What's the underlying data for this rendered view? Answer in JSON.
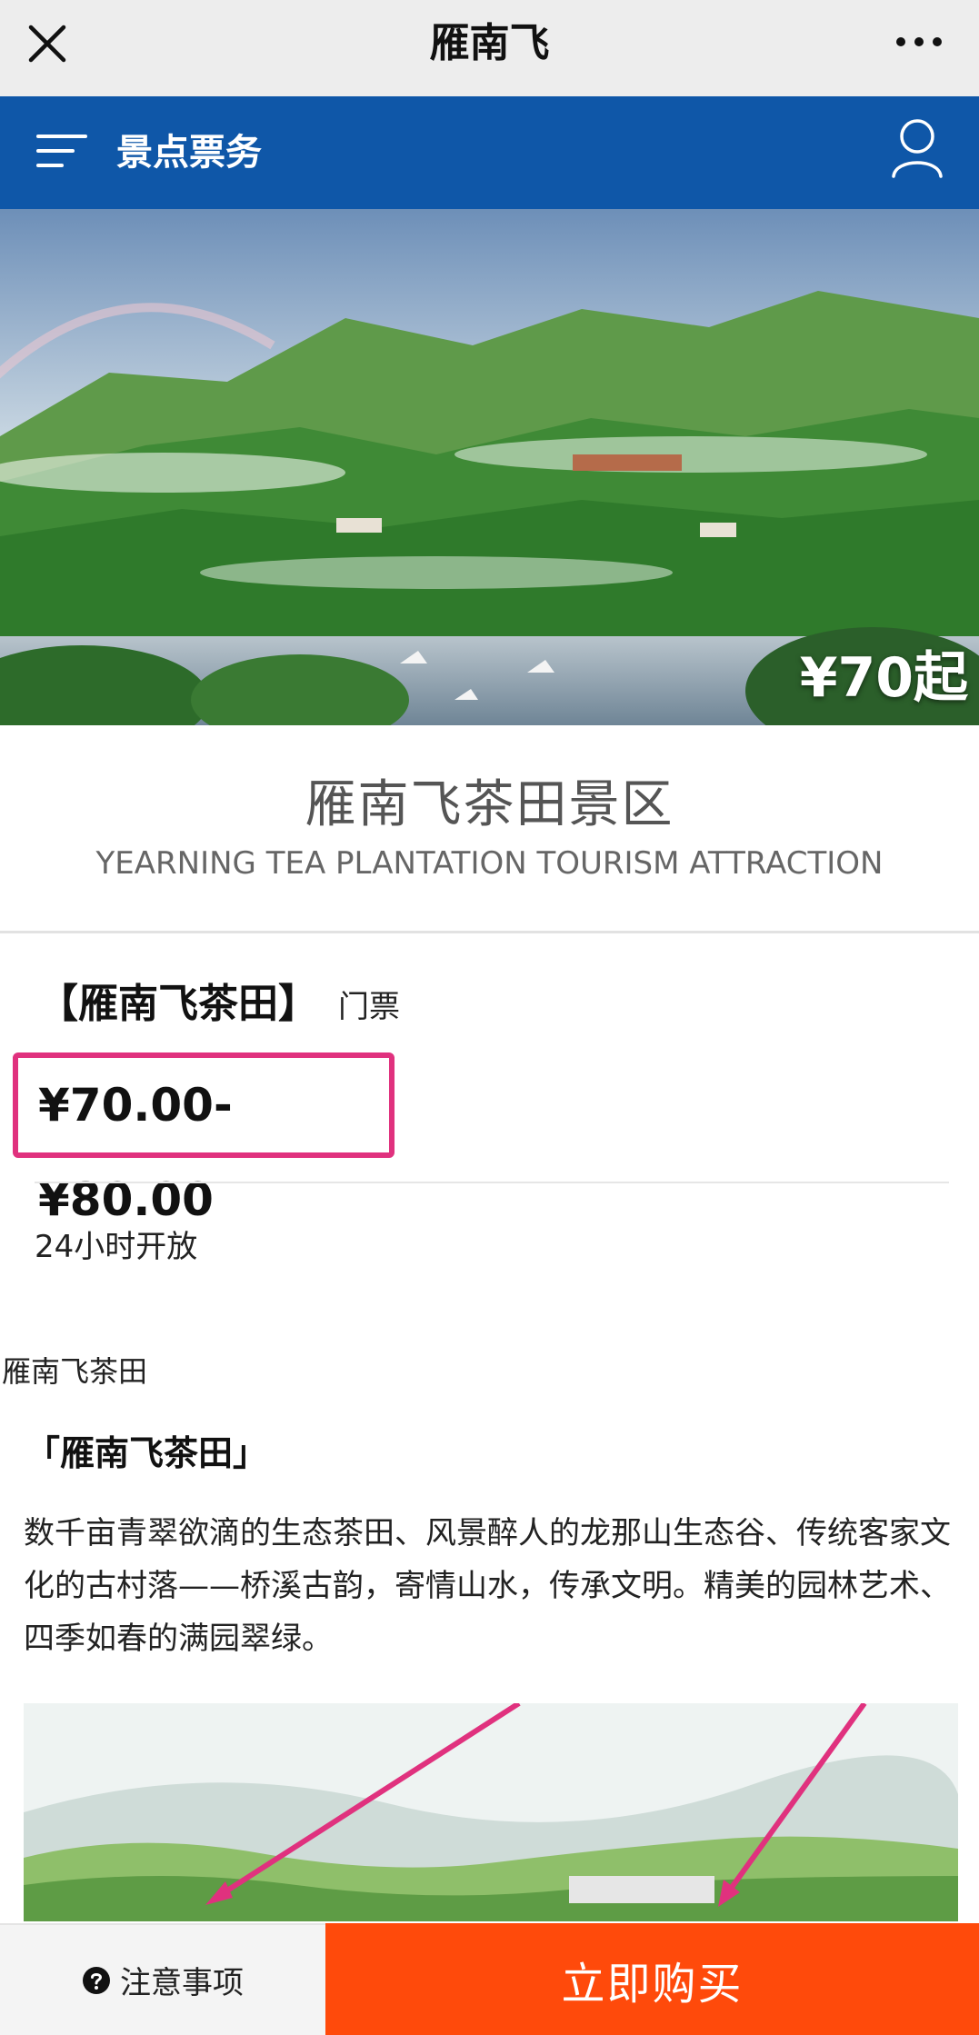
{
  "wechat_bar": {
    "title": "雁南飞",
    "close_icon": "close-icon",
    "more_icon": "more-dots-icon"
  },
  "header": {
    "title": "景点票务",
    "menu_icon": "menu-icon",
    "user_icon": "user-icon",
    "color": "#0f57a8"
  },
  "hero": {
    "price_badge": "¥70起"
  },
  "scenic": {
    "title": "雁南飞茶田景区",
    "subtitle": "YEARNING TEA PLANTATION TOURISM ATTRACTION"
  },
  "ticket": {
    "name": "【雁南飞茶田】",
    "type": "门票",
    "price_range": "¥70.00-¥80.00",
    "highlight_color": "#e0317e",
    "open_hours": "24小时开放"
  },
  "article": {
    "heading": "雁南飞茶田",
    "subheading": "「雁南飞茶田」",
    "body": "数千亩青翠欲滴的生态茶田、风景醉人的龙那山生态谷、传统客家文化的古村落——桥溪古韵，寄情山水，传承文明。精美的园林艺术、四季如春的满园翠绿。"
  },
  "bottom_bar": {
    "notice_label": "注意事项",
    "notice_icon": "question-circle-icon",
    "buy_label": "立即购买",
    "buy_color": "#ff4a0b"
  }
}
